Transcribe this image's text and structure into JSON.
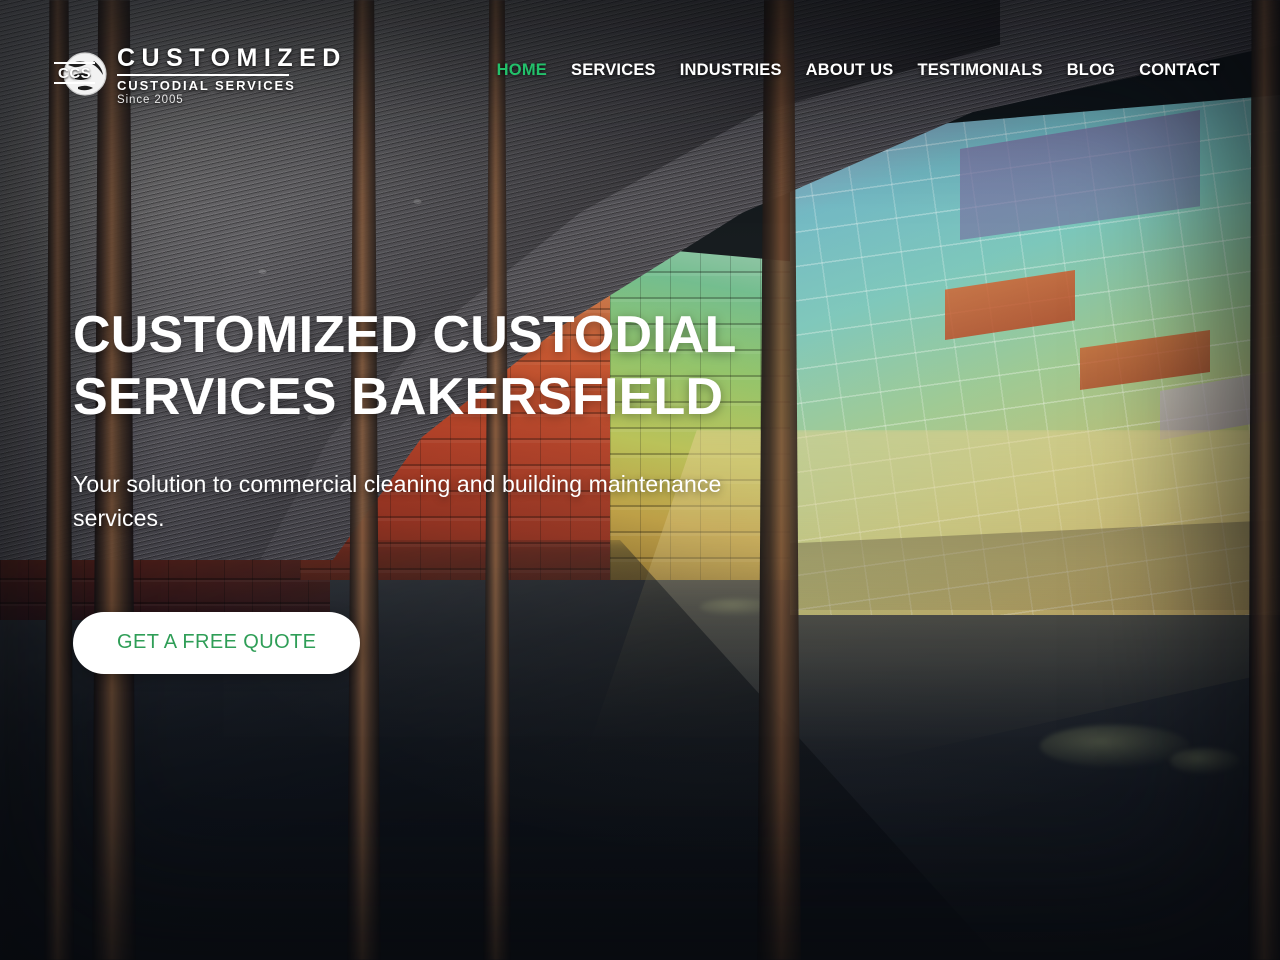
{
  "header": {
    "brand": {
      "badge": "CCS",
      "icon": "globe-icon",
      "line1": "CUSTOMIZED",
      "line2": "CUSTODIAL SERVICES",
      "line3": "Since 2005"
    },
    "nav": {
      "items": [
        {
          "label": "HOME",
          "active": true
        },
        {
          "label": "SERVICES",
          "active": false
        },
        {
          "label": "INDUSTRIES",
          "active": false
        },
        {
          "label": "ABOUT US",
          "active": false
        },
        {
          "label": "TESTIMONIALS",
          "active": false
        },
        {
          "label": "BLOG",
          "active": false
        },
        {
          "label": "CONTACT",
          "active": false
        }
      ]
    }
  },
  "hero": {
    "title": "CUSTOMIZED CUSTODIAL SERVICES BAKERSFIELD",
    "subtitle": "Your solution to commercial cleaning and building maintenance services.",
    "cta_label": "GET A FREE QUOTE"
  },
  "colors": {
    "accent_green": "#23c16b",
    "cta_text_green": "#2f9e57",
    "cta_background": "#ffffff",
    "nav_text": "#ffffff",
    "hero_text": "#ffffff"
  }
}
